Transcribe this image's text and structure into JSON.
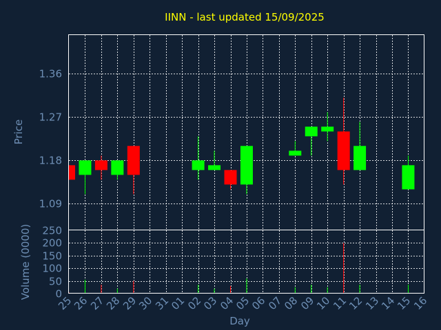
{
  "chart_data": {
    "type": "candlestick",
    "title": "IINN - last updated 15/09/2025",
    "xlabel": "Day",
    "ylabel_price": "Price",
    "ylabel_volume": "Volume (0000)",
    "price_ylim": [
      1.035,
      1.44
    ],
    "price_ticks": [
      "1.09",
      "1.18",
      "1.27",
      "1.36"
    ],
    "volume_ylim": [
      0,
      250
    ],
    "volume_ticks": [
      "0",
      "50",
      "100",
      "150",
      "200",
      "250"
    ],
    "x_labels": [
      "25",
      "26",
      "27",
      "28",
      "29",
      "30",
      "31",
      "01",
      "02",
      "03",
      "04",
      "05",
      "06",
      "07",
      "08",
      "09",
      "10",
      "11",
      "12",
      "13",
      "14",
      "15",
      "16"
    ],
    "grid": true,
    "colors": {
      "up": "#00ff00",
      "down": "#ff0000",
      "background": "#112033",
      "title": "#ffff00",
      "axis_text": "#6e8fb5",
      "frame": "#ffffff"
    },
    "candles": [
      {
        "x": "25",
        "open": 1.17,
        "high": 1.17,
        "low": 1.14,
        "close": 1.14,
        "volume": 5
      },
      {
        "x": "26",
        "open": 1.15,
        "high": 1.18,
        "low": 1.11,
        "close": 1.18,
        "volume": 55
      },
      {
        "x": "27",
        "open": 1.18,
        "high": 1.19,
        "low": 1.14,
        "close": 1.16,
        "volume": 35
      },
      {
        "x": "28",
        "open": 1.15,
        "high": 1.18,
        "low": 1.14,
        "close": 1.18,
        "volume": 20
      },
      {
        "x": "29",
        "open": 1.21,
        "high": 1.21,
        "low": 1.11,
        "close": 1.15,
        "volume": 50
      },
      {
        "x": "02",
        "open": 1.16,
        "high": 1.23,
        "low": 1.14,
        "close": 1.18,
        "volume": 35
      },
      {
        "x": "03",
        "open": 1.16,
        "high": 1.2,
        "low": 1.16,
        "close": 1.17,
        "volume": 20
      },
      {
        "x": "04",
        "open": 1.16,
        "high": 1.16,
        "low": 1.12,
        "close": 1.13,
        "volume": 30
      },
      {
        "x": "05",
        "open": 1.13,
        "high": 1.21,
        "low": 1.11,
        "close": 1.21,
        "volume": 60
      },
      {
        "x": "08",
        "open": 1.19,
        "high": 1.22,
        "low": 1.19,
        "close": 1.2,
        "volume": 25
      },
      {
        "x": "09",
        "open": 1.23,
        "high": 1.25,
        "low": 1.19,
        "close": 1.25,
        "volume": 35
      },
      {
        "x": "10",
        "open": 1.24,
        "high": 1.28,
        "low": 1.22,
        "close": 1.25,
        "volume": 25
      },
      {
        "x": "11",
        "open": 1.24,
        "high": 1.31,
        "low": 1.13,
        "close": 1.16,
        "volume": 200
      },
      {
        "x": "12",
        "open": 1.16,
        "high": 1.26,
        "low": 1.16,
        "close": 1.21,
        "volume": 35
      },
      {
        "x": "15",
        "open": 1.12,
        "high": 1.19,
        "low": 1.12,
        "close": 1.17,
        "volume": 35
      }
    ]
  }
}
